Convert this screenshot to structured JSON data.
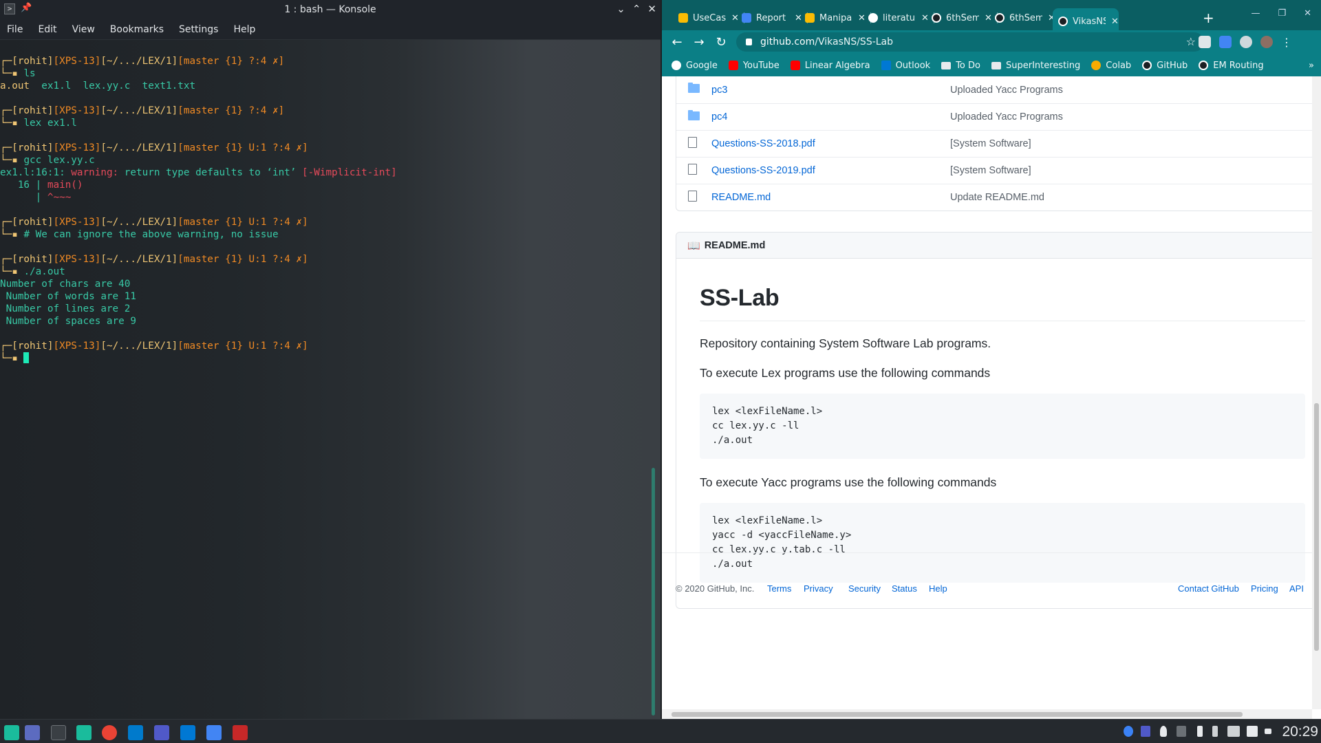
{
  "konsole": {
    "title": "1 : bash — Konsole",
    "app_icon_glyph": ">",
    "window_controls": [
      "⌄",
      "⌃",
      "✕"
    ],
    "menu": [
      "File",
      "Edit",
      "View",
      "Bookmarks",
      "Settings",
      "Help"
    ],
    "prompt": {
      "user": "[rohit]",
      "host": "[XPS-13]",
      "path": "[~/.../LEX/1]",
      "branch_clean": "[master {1} ?:4 ✗]",
      "branch_dirty": "[master {1} U:1 ?:4 ✗]"
    },
    "commands": [
      "ls",
      "lex ex1.l",
      "gcc lex.yy.c",
      "# We can ignore the above warning, no issue",
      "./a.out"
    ],
    "ls_output": [
      "a.out",
      "ex1.l",
      "lex.yy.c",
      "text1.txt"
    ],
    "gcc_output": {
      "location": "ex1.l:16:1:",
      "warning": "warning:",
      "message": "return type defaults to ‘int’",
      "flag": "[-Wimplicit-int]",
      "line_no": "   16 | ",
      "code": "main()",
      "caret_prefix": "      | ",
      "caret": "^~~~"
    },
    "program_output": [
      "Number of chars are 40",
      " Number of words are 11",
      " Number of lines are 2",
      " Number of spaces are 9"
    ]
  },
  "chrome": {
    "tabs": [
      {
        "title": "UseCase",
        "color": "#fbbc04"
      },
      {
        "title": "Report",
        "color": "#4285f4"
      },
      {
        "title": "Manipal",
        "color": "#fbbc04"
      },
      {
        "title": "literature",
        "color": "#ffffff"
      },
      {
        "title": "6thSem",
        "color": "#ffffff"
      },
      {
        "title": "6thSem",
        "color": "#ffffff"
      },
      {
        "title": "VikasNS",
        "color": "#ffffff"
      }
    ],
    "window_controls": [
      "—",
      "❐",
      "✕"
    ],
    "url_host": "github.com",
    "url_path": "/VikasNS/SS-Lab",
    "bookmarks": [
      {
        "label": "Google",
        "color": "#ffffff"
      },
      {
        "label": "YouTube",
        "color": "#ff0000"
      },
      {
        "label": "Linear Algebra",
        "color": "#ff0000"
      },
      {
        "label": "Outlook",
        "color": "#0078d4"
      },
      {
        "label": "To Do",
        "color": "#ffffff"
      },
      {
        "label": "SuperInteresting",
        "color": "#ffffff"
      },
      {
        "label": "Colab",
        "color": "#f9ab00"
      },
      {
        "label": "GitHub",
        "color": "#ffffff"
      },
      {
        "label": "EM Routing",
        "color": "#ffffff"
      }
    ],
    "bookmarks_more": "»",
    "files": [
      {
        "name": "pc3",
        "type": "folder",
        "message": "Uploaded Yacc Programs"
      },
      {
        "name": "pc4",
        "type": "folder",
        "message": "Uploaded Yacc Programs"
      },
      {
        "name": "Questions-SS-2018.pdf",
        "type": "file",
        "message": "[System Software]"
      },
      {
        "name": "Questions-SS-2019.pdf",
        "type": "file",
        "message": "[System Software]"
      },
      {
        "name": "README.md",
        "type": "file",
        "message": "Update README.md"
      }
    ],
    "readme": {
      "header": "README.md",
      "title": "SS-Lab",
      "intro": "Repository containing System Software Lab programs.",
      "lex_heading": "To execute Lex programs use the following commands",
      "lex_code": "lex <lexFileName.l>\ncc lex.yy.c -ll\n./a.out",
      "yacc_heading": "To execute Yacc programs use the following commands",
      "yacc_code": "lex <lexFileName.l>\nyacc -d <yaccFileName.y>\ncc lex.yy.c y.tab.c -ll\n./a.out"
    },
    "footer": {
      "copyright": "© 2020 GitHub, Inc.",
      "links_left": [
        "Terms",
        "Privacy",
        "Security",
        "Status",
        "Help"
      ],
      "links_right": [
        "Contact GitHub",
        "Pricing",
        "API"
      ]
    }
  },
  "taskbar": {
    "clock": "20:29",
    "apps": [
      "application-launcher-icon",
      "desktop-pager-icon",
      "konsole-icon",
      "files-icon",
      "chrome-icon",
      "vscode-icon",
      "teams-icon",
      "outlook-icon",
      "docs-icon",
      "editor-icon"
    ]
  }
}
